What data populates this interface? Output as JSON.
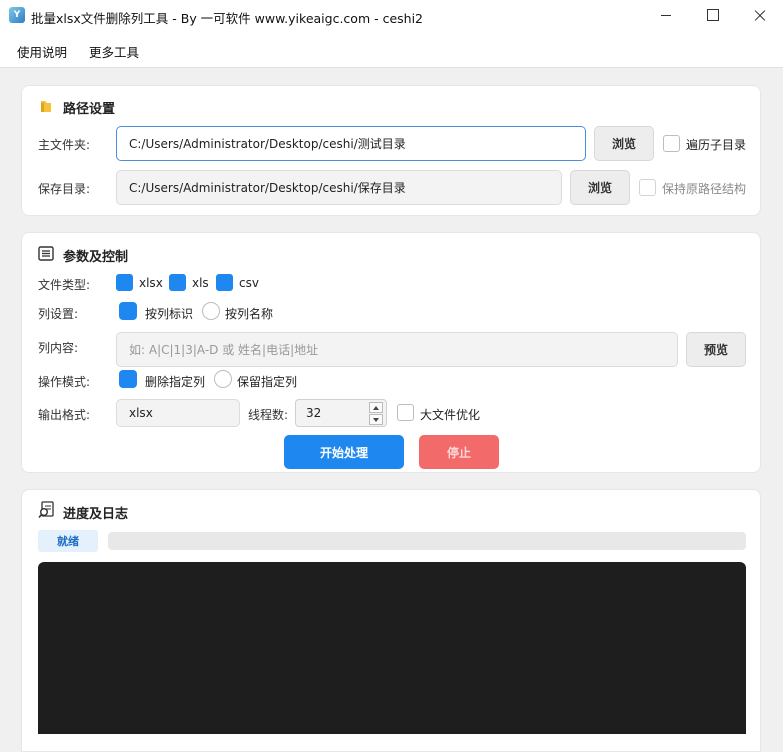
{
  "window": {
    "title": "批量xlsx文件删除列工具 - By 一可软件 www.yikeaigc.com - ceshi2",
    "icon": "app-logo-icon"
  },
  "menu": {
    "items": [
      "使用说明",
      "更多工具"
    ]
  },
  "path_section": {
    "title": "路径设置",
    "icon": "folder-icon",
    "main_folder_label": "主文件夹:",
    "main_folder_value": "C:/Users/Administrator/Desktop/ceshi/测试目录",
    "browse_label": "浏览",
    "recursive_label": "遍历子目录",
    "recursive_checked": false,
    "save_dir_label": "保存目录:",
    "save_dir_value": "C:/Users/Administrator/Desktop/ceshi/保存目录",
    "browse2_label": "浏览",
    "keep_structure_label": "保持原路径结构",
    "keep_structure_checked": false
  },
  "params_section": {
    "title": "参数及控制",
    "icon": "list-icon",
    "file_type_label": "文件类型:",
    "file_types": [
      {
        "label": "xlsx",
        "checked": true
      },
      {
        "label": "xls",
        "checked": true
      },
      {
        "label": "csv",
        "checked": true
      }
    ],
    "column_setting_label": "列设置:",
    "column_modes": [
      {
        "label": "按列标识",
        "selected": true
      },
      {
        "label": "按列名称",
        "selected": false
      }
    ],
    "column_content_label": "列内容:",
    "column_content_placeholder": "如: A|C|1|3|A-D  或  姓名|电话|地址",
    "preview_label": "预览",
    "operation_mode_label": "操作模式:",
    "operation_modes": [
      {
        "label": "删除指定列",
        "selected": true
      },
      {
        "label": "保留指定列",
        "selected": false
      }
    ],
    "output_format_label": "输出格式:",
    "output_format_value": "xlsx",
    "threads_label": "线程数:",
    "threads_value": "32",
    "large_file_label": "大文件优化",
    "large_file_checked": false,
    "start_label": "开始处理",
    "stop_label": "停止"
  },
  "progress_section": {
    "title": "进度及日志",
    "icon": "search-document-icon",
    "status": "就绪",
    "progress": 0,
    "colors": {
      "primary": "#1e88f0",
      "danger": "#f36a6a",
      "log_bg": "#1e1e1e"
    }
  }
}
